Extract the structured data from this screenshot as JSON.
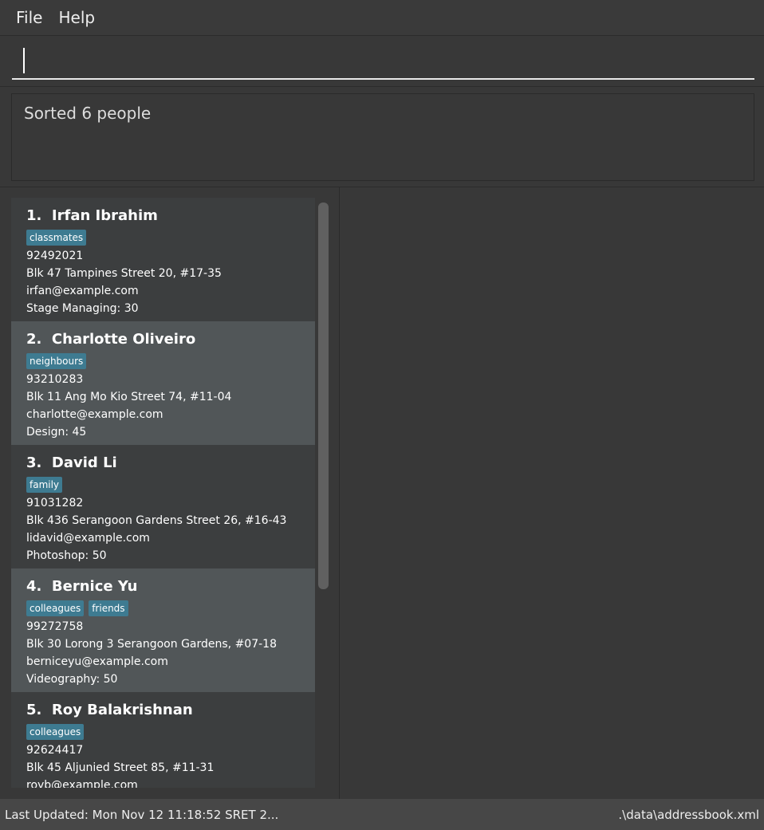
{
  "menu": {
    "file": "File",
    "help": "Help"
  },
  "command": {
    "value": "",
    "placeholder": ""
  },
  "result": {
    "text": "Sorted 6 people"
  },
  "persons": [
    {
      "index": "1.",
      "name": "Irfan Ibrahim",
      "tags": [
        "classmates"
      ],
      "phone": "92492021",
      "address": "Blk 47 Tampines Street 20, #17-35",
      "email": "irfan@example.com",
      "skill": "Stage Managing: 30"
    },
    {
      "index": "2.",
      "name": "Charlotte Oliveiro",
      "tags": [
        "neighbours"
      ],
      "phone": "93210283",
      "address": "Blk 11 Ang Mo Kio Street 74, #11-04",
      "email": "charlotte@example.com",
      "skill": "Design: 45"
    },
    {
      "index": "3.",
      "name": "David Li",
      "tags": [
        "family"
      ],
      "phone": "91031282",
      "address": "Blk 436 Serangoon Gardens Street 26, #16-43",
      "email": "lidavid@example.com",
      "skill": "Photoshop: 50"
    },
    {
      "index": "4.",
      "name": "Bernice Yu",
      "tags": [
        "colleagues",
        "friends"
      ],
      "phone": "99272758",
      "address": "Blk 30 Lorong 3 Serangoon Gardens, #07-18",
      "email": "berniceyu@example.com",
      "skill": "Videography: 50"
    },
    {
      "index": "5.",
      "name": "Roy Balakrishnan",
      "tags": [
        "colleagues"
      ],
      "phone": "92624417",
      "address": "Blk 45 Aljunied Street 85, #11-31",
      "email": "royb@example.com",
      "skill": ""
    }
  ],
  "status": {
    "last_updated": "Last Updated: Mon Nov 12 11:18:52 SRET 2...",
    "file_path": ".\\data\\addressbook.xml"
  },
  "colors": {
    "tag": "#3e7b91",
    "card": "#3c3e3f",
    "card_alt": "#515658",
    "background": "#383838"
  }
}
